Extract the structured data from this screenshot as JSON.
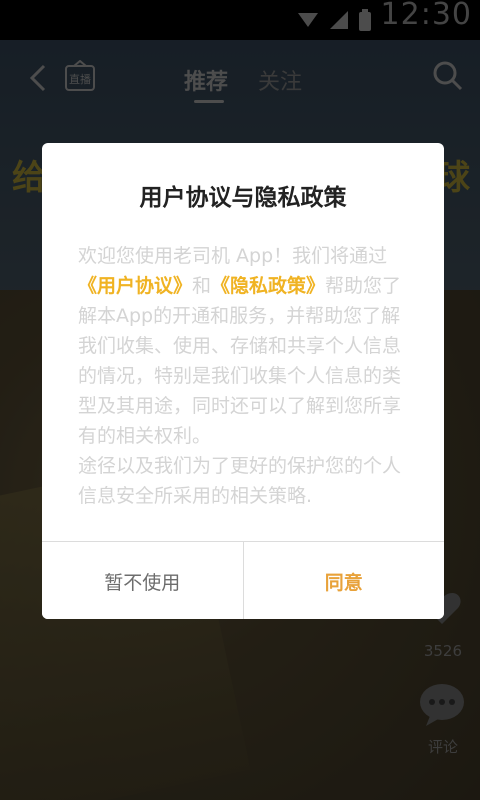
{
  "status_bar": {
    "time": "12:30"
  },
  "background": {
    "left_banner_text": "给",
    "right_banner_text": "球"
  },
  "topbar": {
    "back_icon": "back-arrow-icon",
    "live_icon": "live-icon",
    "live_label": "直播",
    "tab_recommend": "推荐",
    "tab_follow": "关注",
    "search_icon": "search-icon"
  },
  "side": {
    "like_count": "3526",
    "comment_label": "评论"
  },
  "dialog": {
    "title": "用户协议与隐私政策",
    "body_part1": "欢迎您使用老司机 App！我们将通过",
    "link_user_agreement": "《用户协议》",
    "body_and": "和",
    "link_privacy_policy": "《隐私政策》",
    "body_part2": "帮助您了解本App的开通和服务，并帮助您了解我们收集、使用、存储和共享个人信息的情况，特别是我们收集个人信息的类型及其用途，同时还可以了解到您所享有的相关权利。",
    "body_part3": "途径以及我们为了更好的保护您的个人信息安全所采用的相关策略.",
    "decline_label": "暂不使用",
    "agree_label": "同意"
  },
  "colors": {
    "accent": "#f0b323",
    "agree": "#e8a23a"
  }
}
